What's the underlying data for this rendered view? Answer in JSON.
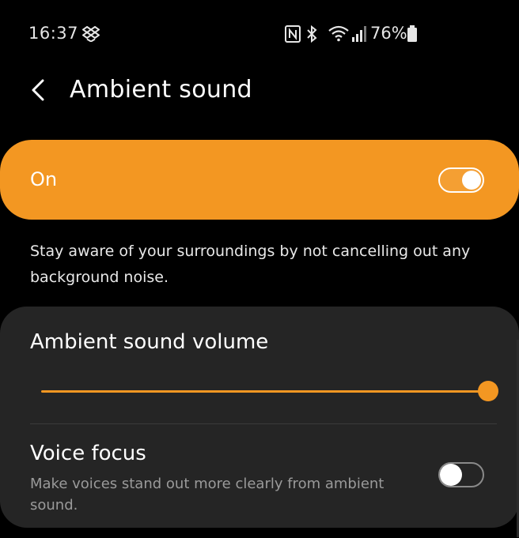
{
  "status_bar": {
    "time": "16:37",
    "battery": "76%",
    "icons": [
      "dropbox-icon",
      "nfc-icon",
      "bluetooth-icon",
      "wifi-icon",
      "signal-icon",
      "battery-icon"
    ]
  },
  "header": {
    "title": "Ambient sound",
    "back_icon": "back-arrow-icon"
  },
  "master_switch": {
    "label": "On",
    "state": true
  },
  "description": "Stay aware of your surroundings by not cancelling out any background noise.",
  "volume": {
    "title": "Ambient sound volume",
    "level": 1.0
  },
  "voice_focus": {
    "title": "Voice focus",
    "description": "Make voices stand out more clearly from ambient sound.",
    "state": false
  },
  "colors": {
    "accent": "#f39722",
    "background": "#000000",
    "card": "#252525"
  }
}
